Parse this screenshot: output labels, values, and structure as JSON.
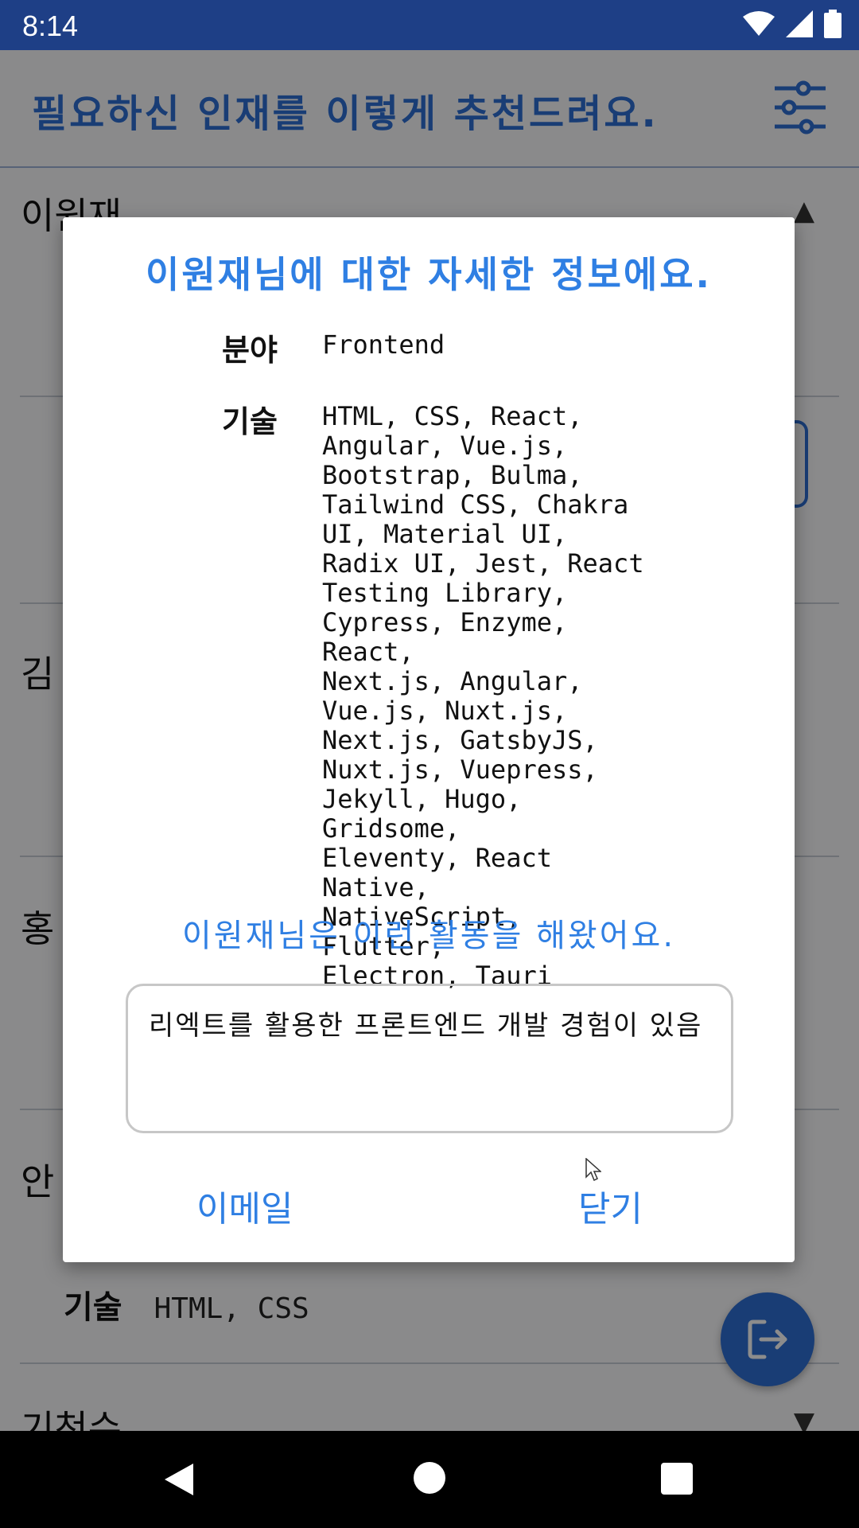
{
  "status_bar": {
    "time": "8:14"
  },
  "app_bar": {
    "title": "필요하신 인재를 이렇게 추천드려요."
  },
  "list": {
    "rows": [
      {
        "name": "이원재"
      },
      {
        "name": "김"
      },
      {
        "name": "홍"
      },
      {
        "name": "안"
      },
      {
        "name": "기천수"
      }
    ],
    "skill_label": "기술",
    "skill_value": "HTML, CSS"
  },
  "dialog": {
    "title": "이원재님에 대한 자세한 정보에요.",
    "field_label": "분야",
    "field_value": "Frontend",
    "skills_label": "기술",
    "skills_lines": [
      "HTML, CSS, React,",
      "Angular, Vue.js,",
      "Bootstrap, Bulma,",
      "Tailwind CSS, Chakra",
      "UI, Material UI,",
      "Radix UI, Jest, React",
      "Testing Library,",
      "Cypress, Enzyme, React,",
      "Next.js, Angular,",
      "Vue.js, Nuxt.js,",
      "Next.js, GatsbyJS,",
      "Nuxt.js, Vuepress,",
      "Jekyll, Hugo, Gridsome,",
      "Eleventy, React Native,",
      "NativeScript, Flutter,",
      "Electron, Tauri"
    ],
    "activity_title": "이원재님은 이런 활동을 해왔어요.",
    "activity_text": "리엑트를 활용한 프론트엔드 개발 경험이 있음",
    "email_button": "이메일",
    "close_button": "닫기"
  },
  "colors": {
    "accent": "#2f7fe3",
    "status_bar": "#1e3f86",
    "fab": "#2f6fd6"
  },
  "icons": [
    "wifi-icon",
    "signal-icon",
    "battery-icon",
    "filter-icon",
    "logout-icon",
    "back-icon",
    "home-icon",
    "recents-icon"
  ]
}
